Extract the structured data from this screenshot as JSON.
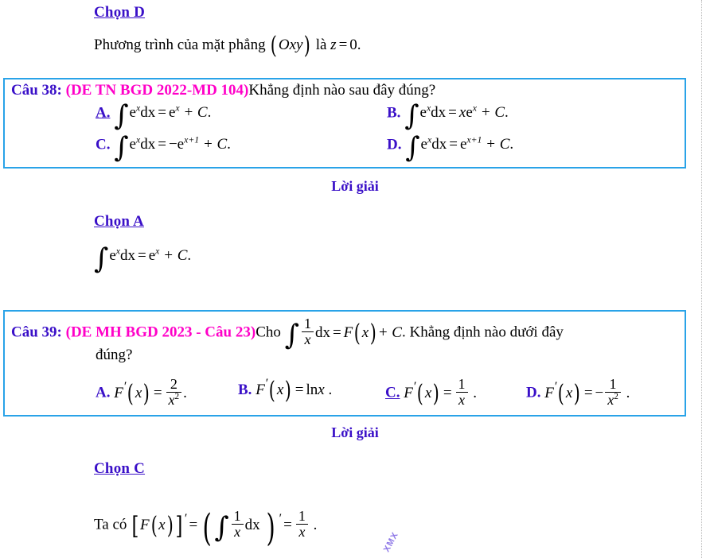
{
  "document": {
    "language": "vi",
    "colors": {
      "accent_box_border": "#29a3e8",
      "label_blue": "#3a10c8",
      "source_magenta": "#ff00c8",
      "text_black": "#000000"
    }
  },
  "top_section": {
    "choose_label": "Chọn D",
    "explanation": {
      "prefix": "Phương trình của mặt phẳng",
      "plane": "Oxy",
      "middle": "là",
      "equation_lhs": "z",
      "equation_op": "=",
      "equation_rhs": "0",
      "period": "."
    }
  },
  "question_38": {
    "number_label": "Câu 38:",
    "source": "(DE TN BGD 2022-MD 104)",
    "stem": "Khẳng định nào sau đây đúng?",
    "correct_option": "A",
    "options": [
      {
        "key": "A",
        "label": "A.",
        "correct": true,
        "integrand_base": "e",
        "integrand_exp": "x",
        "differential": "dx",
        "equals": "=",
        "rhs_coef": "",
        "rhs_base": "e",
        "rhs_exp": "x",
        "plus_c": "+ C",
        "period": "."
      },
      {
        "key": "B",
        "label": "B.",
        "correct": false,
        "integrand_base": "e",
        "integrand_exp": "x",
        "differential": "dx",
        "equals": "=",
        "rhs_coef": "x",
        "rhs_base": "e",
        "rhs_exp": "x",
        "plus_c": "+ C",
        "period": "."
      },
      {
        "key": "C",
        "label": "C.",
        "correct": false,
        "integrand_base": "e",
        "integrand_exp": "x",
        "differential": "dx",
        "equals": "=",
        "rhs_coef": "−",
        "rhs_base": "e",
        "rhs_exp": "x+1",
        "plus_c": "+ C",
        "period": "."
      },
      {
        "key": "D",
        "label": "D.",
        "correct": false,
        "integrand_base": "e",
        "integrand_exp": "x",
        "differential": "dx",
        "equals": "=",
        "rhs_coef": "",
        "rhs_base": "e",
        "rhs_exp": "x+1",
        "plus_c": "+ C",
        "period": "."
      }
    ],
    "solution_heading": "Lời giải",
    "choose_label": "Chọn A",
    "solution_equation": {
      "integrand_base": "e",
      "integrand_exp": "x",
      "differential": "dx",
      "equals": "=",
      "rhs_base": "e",
      "rhs_exp": "x",
      "plus_c": "+ C",
      "period": "."
    }
  },
  "question_39": {
    "number_label": "Câu 39:",
    "source": "(DE MH BGD 2023 - Câu 23)",
    "stem_prefix": "Cho",
    "stem_integral": {
      "num": "1",
      "den": "x",
      "differential": "dx",
      "equals": "=",
      "rhs_func": "F",
      "rhs_var": "x",
      "plus_c": "+ C",
      "period": "."
    },
    "stem_suffix_line1": "Khẳng định nào dưới đây",
    "stem_suffix_line2": "đúng?",
    "correct_option": "C",
    "options": [
      {
        "key": "A",
        "label": "A.",
        "correct": false,
        "lhs_func": "F",
        "lhs_prime": "′",
        "lhs_var": "x",
        "equals": "=",
        "rhs_sign": "",
        "rhs_type": "fraction",
        "rhs_num": "2",
        "rhs_den": "x",
        "rhs_den_exp": "2",
        "period": "."
      },
      {
        "key": "B",
        "label": "B.",
        "correct": false,
        "lhs_func": "F",
        "lhs_prime": "′",
        "lhs_var": "x",
        "equals": "=",
        "rhs_sign": "",
        "rhs_type": "text",
        "rhs_text": "ln",
        "rhs_text_var": "x",
        "period": "."
      },
      {
        "key": "C",
        "label": "C.",
        "correct": true,
        "lhs_func": "F",
        "lhs_prime": "′",
        "lhs_var": "x",
        "equals": "=",
        "rhs_sign": "",
        "rhs_type": "fraction",
        "rhs_num": "1",
        "rhs_den": "x",
        "rhs_den_exp": "",
        "period": "."
      },
      {
        "key": "D",
        "label": "D.",
        "correct": false,
        "lhs_func": "F",
        "lhs_prime": "′",
        "lhs_var": "x",
        "equals": "=",
        "rhs_sign": "−",
        "rhs_type": "fraction",
        "rhs_num": "1",
        "rhs_den": "x",
        "rhs_den_exp": "2",
        "period": "."
      }
    ],
    "solution_heading": "Lời giải",
    "choose_label": "Chọn C",
    "solution_equation": {
      "prefix": "Ta có",
      "func": "F",
      "var": "x",
      "prime": "′",
      "equals1": "=",
      "int_num": "1",
      "int_den": "x",
      "differential": "dx",
      "equals2": "=",
      "result_num": "1",
      "result_den": "x",
      "period": "."
    }
  },
  "watermark": {
    "text": "XMX"
  }
}
